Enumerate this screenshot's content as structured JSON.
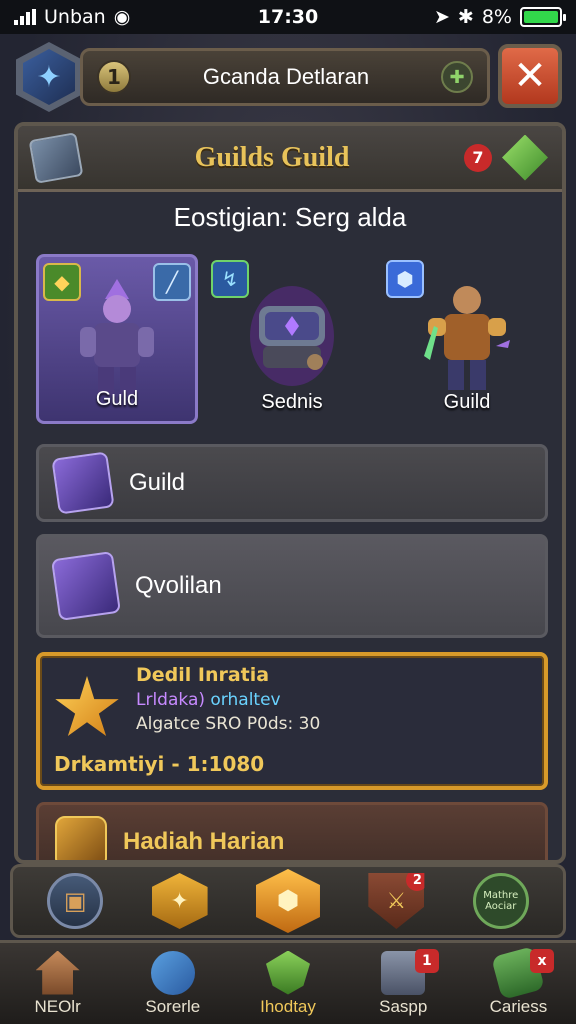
{
  "status_bar": {
    "carrier": "Unban",
    "time": "17:30",
    "battery_percent": "8%"
  },
  "header": {
    "level": "1",
    "title": "Gcanda Detlaran"
  },
  "panel": {
    "title": "Guilds Guild",
    "notification_count": "7",
    "subtitle": "Eostigian: Serg alda"
  },
  "cards": [
    {
      "label": "Guld"
    },
    {
      "label": "Sednis"
    },
    {
      "label": "Guild"
    }
  ],
  "list_items": [
    {
      "label": "Guild"
    },
    {
      "label": "Qvolilan"
    }
  ],
  "reward": {
    "title": "Dedil Inratia",
    "subtitle_a": "Lrldaka)",
    "subtitle_b": "orhaltev",
    "description": "Algatce SRO P0ds: 30",
    "progress": "Drkamtiyi - 1:1080"
  },
  "daily": {
    "label": "Hadiah Harian"
  },
  "action_bar": {
    "badge_count": "2",
    "round_btn_text": "Mathre Aociar"
  },
  "bottom_nav": [
    {
      "label": "NEOlr",
      "icon": "home-icon"
    },
    {
      "label": "Sorerle",
      "icon": "search-icon"
    },
    {
      "label": "Ihodtay",
      "icon": "shield-icon"
    },
    {
      "label": "Saspp",
      "icon": "shop-icon",
      "badge": "1"
    },
    {
      "label": "Cariess",
      "icon": "cards-icon",
      "badge": "x"
    }
  ],
  "colors": {
    "gold": "#f0c85a",
    "reward_border": "#d89a2a",
    "close": "#c8482a",
    "badge": "#c82a2a"
  }
}
